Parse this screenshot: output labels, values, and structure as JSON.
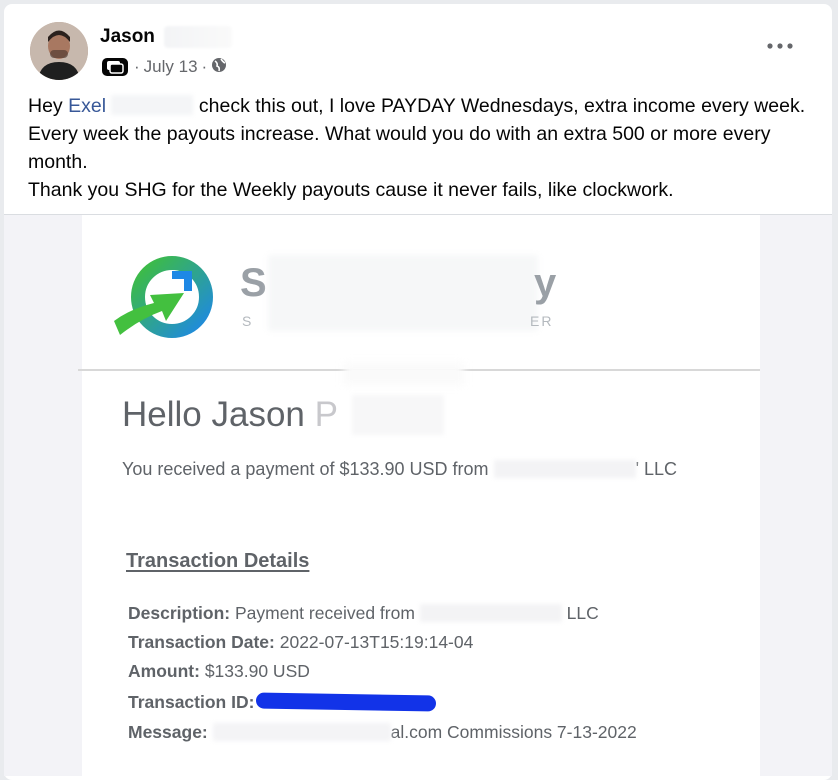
{
  "post": {
    "author": "Jason",
    "date": "July 13",
    "separator": "·",
    "text_greeting": "Hey ",
    "mention": "Exel",
    "text_line1_rest": "check this out, I love PAYDAY Wednesdays, extra income every week. Every week the payouts increase. What would you do with an extra 500 or more every month.",
    "text_line2": "Thank you SHG for the Weekly payouts cause it never fails, like clockwork."
  },
  "email": {
    "brand_first": "S",
    "brand_last": "y",
    "brand_tag_first": "S",
    "brand_tag_last": "ER",
    "hello": "Hello Jason",
    "hello_initial": "P",
    "received_prefix": "You received a payment of $133.90 USD from",
    "received_suffix": "' LLC",
    "details_heading": "Transaction Details",
    "rows": {
      "description_label": "Description:",
      "description_value": "Payment received from",
      "description_suffix": "LLC",
      "date_label": "Transaction Date:",
      "date_value": "2022-07-13T15:19:14-04",
      "amount_label": "Amount:",
      "amount_value": "$133.90 USD",
      "id_label": "Transaction ID:",
      "message_label": "Message:",
      "message_value": "al.com Commissions 7-13-2022"
    }
  },
  "colors": {
    "mention": "#385898",
    "redaction": "#1233e8",
    "logo_green": "#3fbf3a",
    "logo_blue": "#1e88e5"
  },
  "icons": [
    "audience-friends-icon",
    "globe-icon",
    "more-options-icon"
  ]
}
